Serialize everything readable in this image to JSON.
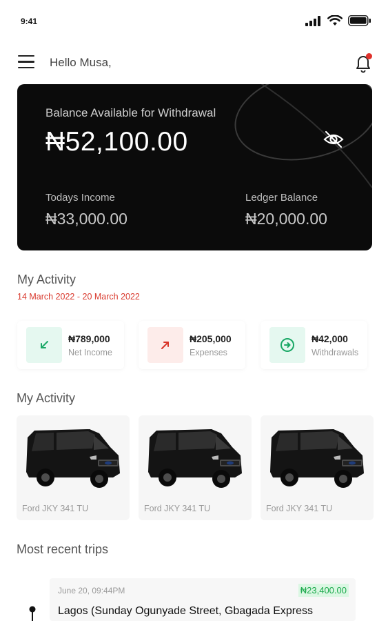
{
  "status_bar": {
    "time": "9:41"
  },
  "header": {
    "greeting": "Hello Musa,"
  },
  "balance": {
    "label": "Balance Available for Withdrawal",
    "amount": "₦52,100.00",
    "today_label": "Todays Income",
    "today_amount": "₦33,000.00",
    "ledger_label": "Ledger Balance",
    "ledger_amount": "₦20,000.00"
  },
  "activity": {
    "title": "My Activity",
    "date_range": "14 March 2022 - 20 March 2022",
    "stats": [
      {
        "value": "₦789,000",
        "label": "Net Income",
        "icon": "arrow-down-left-icon",
        "color": "#1aa866",
        "bg": "#e5f8f0"
      },
      {
        "value": "₦205,000",
        "label": "Expenses",
        "icon": "arrow-up-right-icon",
        "color": "#d9362b",
        "bg": "#fdecea"
      },
      {
        "value": "₦42,000",
        "label": "Withdrawals",
        "icon": "arrow-circle-right-icon",
        "color": "#1aa866",
        "bg": "#e5f8f0"
      }
    ]
  },
  "vehicles": {
    "title": "My Activity",
    "items": [
      {
        "name": "Ford JKY 341 TU"
      },
      {
        "name": "Ford JKY 341 TU"
      },
      {
        "name": "Ford JKY 341 TU"
      }
    ]
  },
  "recent_trips": {
    "title": "Most recent trips",
    "items": [
      {
        "date": "June 20, 09:44PM",
        "amount": "₦23,400.00",
        "route": "Lagos (Sunday Ogunyade Street, Gbagada Express"
      }
    ]
  },
  "colors": {
    "card_bg": "#0b0b0b",
    "accent_red": "#d93a2e",
    "accent_green": "#1aa866",
    "notification_dot": "#e0312b"
  }
}
